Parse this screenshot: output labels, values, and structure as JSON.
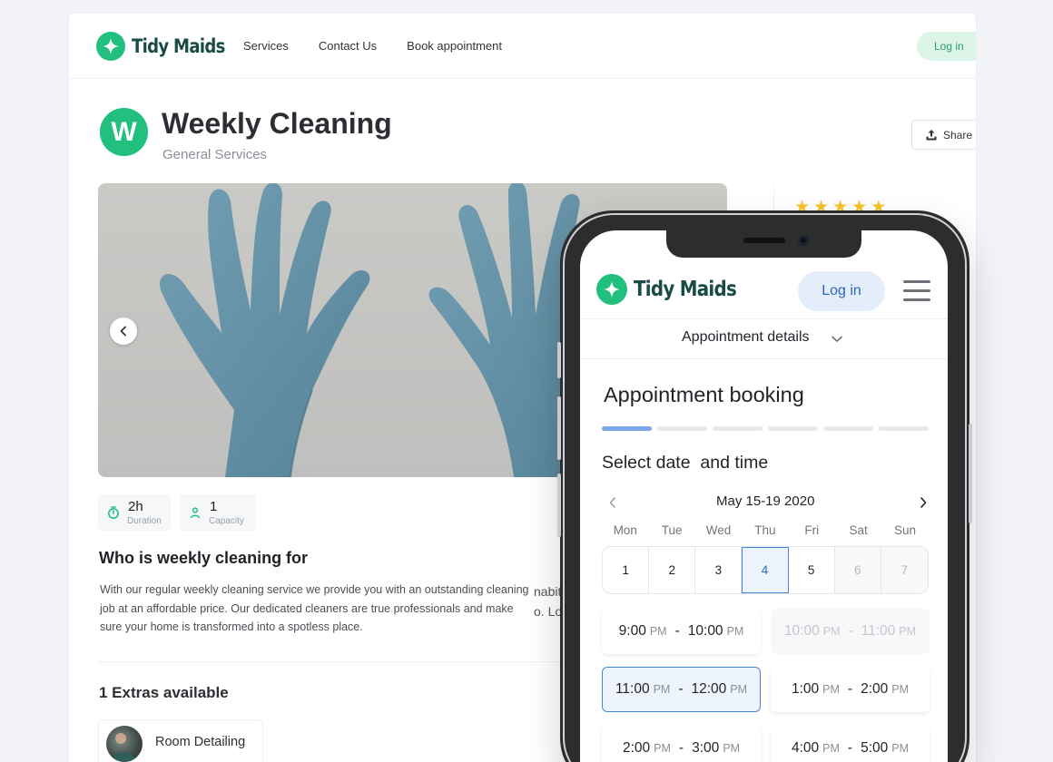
{
  "brand": {
    "name": "Tidy Maids",
    "accent": "#22c07e",
    "logo_icon": "sparkle-icon"
  },
  "desktop": {
    "nav": {
      "links": [
        "Services",
        "Contact Us",
        "Book appointment"
      ],
      "login_label": "Log in"
    },
    "service": {
      "badge_letter": "W",
      "title": "Weekly Cleaning",
      "category": "General Services",
      "share_label": "Share",
      "rating_stars": 5
    },
    "chips": [
      {
        "value": "2h",
        "label": "Duration",
        "icon": "timer-icon"
      },
      {
        "value": "1",
        "label": "Capacity",
        "icon": "person-icon"
      }
    ],
    "who": {
      "title": "Who is weekly cleaning for",
      "description": "With our regular weekly cleaning service we provide you with an outstanding cleaning job at an affordable price. Our dedicated cleaners are true professionals and make sure your home is transformed into a spotless place.",
      "overflow_line1": "nabit",
      "overflow_line2": "o. Lo"
    },
    "extras": {
      "title": "1 Extras available",
      "items": [
        {
          "name": "Room Detailing"
        }
      ]
    }
  },
  "mobile": {
    "login_label": "Log in",
    "sub_nav_label": "Appointment details",
    "booking_title": "Appointment booking",
    "progress": {
      "total_steps": 6,
      "current_step": 1
    },
    "select_title": "Select date  and time",
    "calendar": {
      "range": "May 15-19 2020",
      "weekdays": [
        "Mon",
        "Tue",
        "Wed",
        "Thu",
        "Fri",
        "Sat",
        "Sun"
      ],
      "days": [
        {
          "label": "1",
          "state": "available"
        },
        {
          "label": "2",
          "state": "available"
        },
        {
          "label": "3",
          "state": "available"
        },
        {
          "label": "4",
          "state": "selected"
        },
        {
          "label": "5",
          "state": "available"
        },
        {
          "label": "6",
          "state": "disabled"
        },
        {
          "label": "7",
          "state": "disabled"
        }
      ]
    },
    "slots": [
      {
        "start": "9:00",
        "start_period": "PM",
        "end": "10:00",
        "end_period": "PM",
        "state": "available"
      },
      {
        "start": "10:00",
        "start_period": "PM",
        "end": "11:00",
        "end_period": "PM",
        "state": "disabled"
      },
      {
        "start": "11:00",
        "start_period": "PM",
        "end": "12:00",
        "end_period": "PM",
        "state": "selected"
      },
      {
        "start": "1:00",
        "start_period": "PM",
        "end": "2:00",
        "end_period": "PM",
        "state": "available"
      },
      {
        "start": "2:00",
        "start_period": "PM",
        "end": "3:00",
        "end_period": "PM",
        "state": "available"
      },
      {
        "start": "4:00",
        "start_period": "PM",
        "end": "5:00",
        "end_period": "PM",
        "state": "available"
      }
    ],
    "slot_separator": "-"
  }
}
